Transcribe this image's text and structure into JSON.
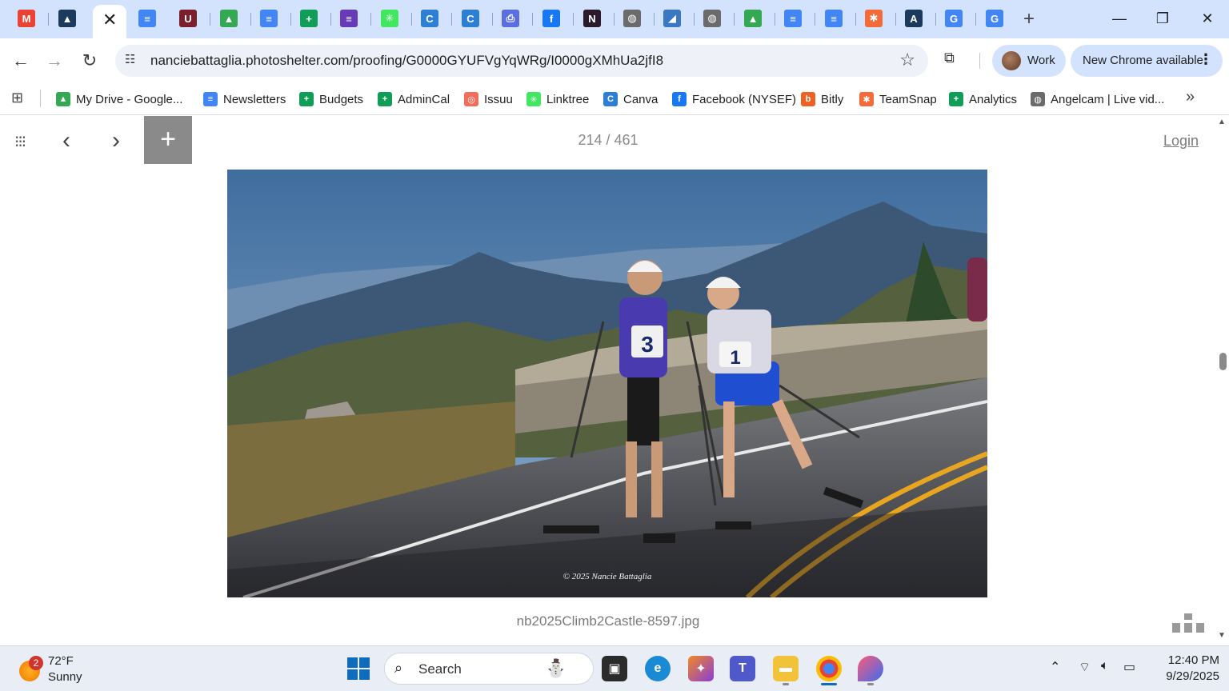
{
  "window": {
    "close_tab_glyph": "✕",
    "new_tab_glyph": "+",
    "minimize_glyph": "—",
    "restore_glyph": "❐",
    "close_glyph": "✕"
  },
  "tabs": [
    {
      "icon": "gmail-icon",
      "glyph": "M",
      "color": "#ea4335"
    },
    {
      "icon": "photoshelter-icon",
      "glyph": "▲",
      "color": "#1b3a5c"
    },
    {
      "icon": "docs-icon",
      "glyph": "≡",
      "color": "#4285f4"
    },
    {
      "icon": "app-icon",
      "glyph": "U",
      "color": "#7a1f2b"
    },
    {
      "icon": "drive-icon",
      "glyph": "▲",
      "color": "#34a853"
    },
    {
      "icon": "docs-icon",
      "glyph": "≡",
      "color": "#4285f4"
    },
    {
      "icon": "sheets-icon",
      "glyph": "+",
      "color": "#0f9d58"
    },
    {
      "icon": "forms-icon",
      "glyph": "≡",
      "color": "#673ab7"
    },
    {
      "icon": "linktree-icon",
      "glyph": "✳",
      "color": "#43e660"
    },
    {
      "icon": "canva-icon",
      "glyph": "C",
      "color": "#2d7fd3"
    },
    {
      "icon": "canva-icon",
      "glyph": "C",
      "color": "#2d7fd3"
    },
    {
      "icon": "printer-icon",
      "glyph": "⎙",
      "color": "#5b6ee1"
    },
    {
      "icon": "facebook-icon",
      "glyph": "f",
      "color": "#1877f2"
    },
    {
      "icon": "app-icon",
      "glyph": "N",
      "color": "#2a1a2a"
    },
    {
      "icon": "globe-icon",
      "glyph": "◍",
      "color": "#6b6b6b"
    },
    {
      "icon": "app-icon",
      "glyph": "◢",
      "color": "#3a78c3"
    },
    {
      "icon": "globe-icon",
      "glyph": "◍",
      "color": "#6b6b6b"
    },
    {
      "icon": "drive-icon",
      "glyph": "▲",
      "color": "#34a853"
    },
    {
      "icon": "docs-icon",
      "glyph": "≡",
      "color": "#4285f4"
    },
    {
      "icon": "docs-icon",
      "glyph": "≡",
      "color": "#4285f4"
    },
    {
      "icon": "teamsnap-icon",
      "glyph": "✱",
      "color": "#f26b38"
    },
    {
      "icon": "app-icon",
      "glyph": "A",
      "color": "#1b3a5c"
    },
    {
      "icon": "google-icon",
      "glyph": "G",
      "color": "#4285f4"
    },
    {
      "icon": "google-icon",
      "glyph": "G",
      "color": "#4285f4"
    }
  ],
  "toolbar": {
    "url": "nanciebattaglia.photoshelter.com/proofing/G0000GYUFVgYqWRg/I0000gXMhUa2jfI8",
    "profile_label": "Work",
    "update_label": "New Chrome available"
  },
  "bookmarks": [
    {
      "label": "My Drive - Google...",
      "icon": "drive-icon",
      "glyph": "▲",
      "color": "#34a853"
    },
    {
      "label": "Newsletters",
      "icon": "docs-icon",
      "glyph": "≡",
      "color": "#4285f4"
    },
    {
      "label": "Budgets",
      "icon": "sheets-icon",
      "glyph": "+",
      "color": "#0f9d58"
    },
    {
      "label": "AdminCal",
      "icon": "sheets-icon",
      "glyph": "+",
      "color": "#0f9d58"
    },
    {
      "label": "Issuu",
      "icon": "issuu-icon",
      "glyph": "◎",
      "color": "#f36d5d"
    },
    {
      "label": "Linktree",
      "icon": "linktree-icon",
      "glyph": "✳",
      "color": "#43e660"
    },
    {
      "label": "Canva",
      "icon": "canva-icon",
      "glyph": "C",
      "color": "#2d7fd3"
    },
    {
      "label": "Facebook (NYSEF)",
      "icon": "facebook-icon",
      "glyph": "f",
      "color": "#1877f2"
    },
    {
      "label": "Bitly",
      "icon": "bitly-icon",
      "glyph": "b",
      "color": "#ee6123"
    },
    {
      "label": "TeamSnap",
      "icon": "teamsnap-icon",
      "glyph": "✱",
      "color": "#f26b38"
    },
    {
      "label": "Analytics",
      "icon": "sheets-icon",
      "glyph": "+",
      "color": "#0f9d58"
    },
    {
      "label": "Angelcam | Live vid...",
      "icon": "globe-icon",
      "glyph": "◍",
      "color": "#6b6b6b"
    }
  ],
  "viewer": {
    "counter": "214 / 461",
    "login_label": "Login",
    "filename": "nb2025Climb2Castle-8597.jpg",
    "watermark": "© 2025 Nancie Battaglia",
    "bib_left": "3",
    "bib_right": "1"
  },
  "taskbar": {
    "weather_badge": "2",
    "temperature": "72°F",
    "condition": "Sunny",
    "search_label": "Search",
    "time": "12:40 PM",
    "date": "9/29/2025"
  }
}
